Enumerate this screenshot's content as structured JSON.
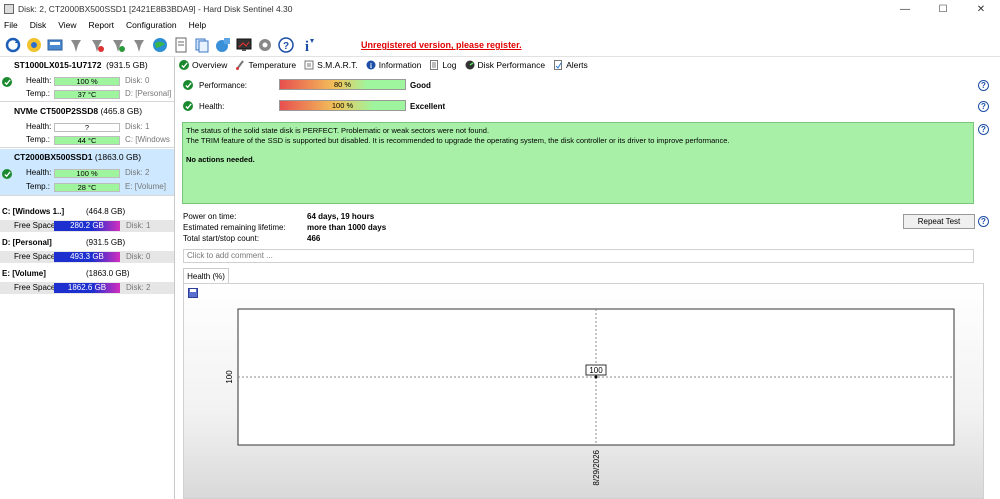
{
  "window": {
    "title": "Disk: 2, CT2000BX500SSD1 [2421E8B3BDA9]  -  Hard Disk Sentinel 4.30",
    "controls": [
      "—",
      "☐",
      "✕"
    ]
  },
  "menu": [
    "File",
    "Disk",
    "View",
    "Report",
    "Configuration",
    "Help"
  ],
  "toolbar": {
    "icons": [
      "refresh-icon",
      "alert-icon",
      "disk-icon",
      "pin-icon",
      "pin-icon",
      "pin-icon",
      "pin-icon",
      "globe-icon",
      "document-icon",
      "copy-icon",
      "globe-link-icon",
      "monitor-icon",
      "gear-icon",
      "help-icon",
      "info-icon"
    ],
    "unregistered": "Unregistered version, please register."
  },
  "disks": [
    {
      "name": "ST1000LX015-1U7172",
      "capacity": "(931.5 GB)",
      "health_label": "Health:",
      "health": "100 %",
      "health_side": "Disk: 0",
      "temp_label": "Temp.:",
      "temp": "37 °C",
      "temp_side": "D: [Personal]"
    },
    {
      "name": "NVMe   CT500P2SSD8",
      "capacity": "(465.8 GB)",
      "health_label": "Health:",
      "health": "?",
      "health_side": "Disk: 1",
      "temp_label": "Temp.:",
      "temp": "44 °C",
      "temp_side": "C: [Windows"
    },
    {
      "name": "CT2000BX500SSD1",
      "capacity": "(1863.0 GB)",
      "health_label": "Health:",
      "health": "100 %",
      "health_side": "Disk: 2",
      "temp_label": "Temp.:",
      "temp": "28 °C",
      "temp_side": "E: [Volume]"
    }
  ],
  "volumes": [
    {
      "name": "C: [Windows 1..]",
      "capacity": "(464.8 GB)",
      "free_label": "Free Space",
      "free": "280.2 GB",
      "disk": "Disk: 1"
    },
    {
      "name": "D: [Personal]",
      "capacity": "(931.5 GB)",
      "free_label": "Free Space",
      "free": "493.3 GB",
      "disk": "Disk: 0"
    },
    {
      "name": "E: [Volume]",
      "capacity": "(1863.0 GB)",
      "free_label": "Free Space",
      "free": "1862.6 GB",
      "disk": "Disk: 2"
    }
  ],
  "tabs": [
    "Overview",
    "Temperature",
    "S.M.A.R.T.",
    "Information",
    "Log",
    "Disk Performance",
    "Alerts"
  ],
  "overview": {
    "performance_label": "Performance:",
    "performance_value": "80 %",
    "performance_word": "Good",
    "health_label": "Health:",
    "health_value": "100 %",
    "health_word": "Excellent",
    "status_line1": "The status of the solid state disk is PERFECT. Problematic or weak sectors were not found.",
    "status_line2": "The TRIM feature of the SSD is supported but disabled. It is recommended to upgrade the operating system, the disk controller or its driver to improve performance.",
    "status_action": "No actions needed.",
    "power_on_label": "Power on time:",
    "power_on_value": "64 days, 19 hours",
    "lifetime_label": "Estimated remaining lifetime:",
    "lifetime_value": "more than 1000 days",
    "startstop_label": "Total start/stop count:",
    "startstop_value": "466",
    "repeat_button": "Repeat Test",
    "comment_placeholder": "Click to add comment ...",
    "chart_tab": "Health (%)"
  },
  "chart_data": {
    "type": "line",
    "x": [
      "8/29/2026"
    ],
    "series": [
      {
        "values": [
          100
        ]
      }
    ],
    "ytick": "100",
    "point_label": "100"
  }
}
